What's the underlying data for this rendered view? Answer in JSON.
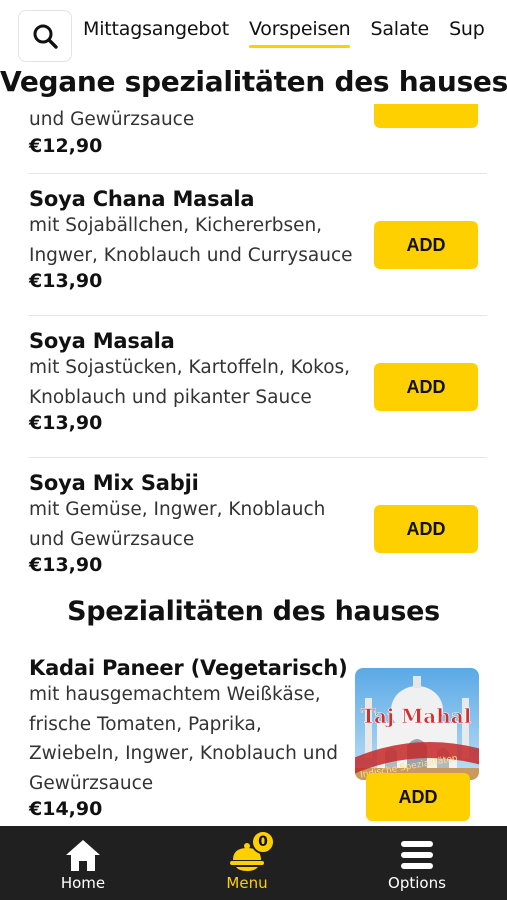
{
  "nav": {
    "tabs": [
      {
        "label": "Mittagsangebot"
      },
      {
        "label": "Vorspeisen"
      },
      {
        "label": "Salate"
      },
      {
        "label": "Sup"
      }
    ],
    "active_tab": "Vorspeisen"
  },
  "sticky_heading": "Vegane spezialitäten des hauses",
  "items": [
    {
      "desc_line": "und Gewürzsauce",
      "price": "€12,90"
    },
    {
      "name": "Soya Chana Masala",
      "desc": [
        "mit Sojabällchen, Kichererbsen,",
        "Ingwer, Knoblauch und Currysauce"
      ],
      "price": "€13,90",
      "add_label": "ADD"
    },
    {
      "name": "Soya Masala",
      "desc": [
        "mit Sojastücken, Kartoffeln, Kokos,",
        "Knoblauch und pikanter Sauce"
      ],
      "price": "€13,90",
      "add_label": "ADD"
    },
    {
      "name": "Soya Mix Sabji",
      "desc": [
        "mit Gemüse, Ingwer, Knoblauch",
        "und Gewürzsauce"
      ],
      "price": "€13,90",
      "add_label": "ADD"
    }
  ],
  "section2_heading": "Spezialitäten des hauses",
  "paneer": {
    "name": "Kadai Paneer (Vegetarisch)",
    "desc": [
      "mit hausgemachtem Weißkäse,",
      "frische Tomaten, Paprika,",
      "Zwiebeln, Ingwer, Knoblauch und",
      "Gewürzsauce"
    ],
    "price": "€14,90",
    "add_label": "ADD",
    "image_logo_text": "Taj Mahal",
    "image_sub_text": "Indische Spezialitäten"
  },
  "bottom_nav": {
    "home": "Home",
    "menu": "Menu",
    "options": "Options",
    "cart_count": "0"
  },
  "colors": {
    "accent": "#ffd000",
    "nav_bg": "#202020"
  }
}
